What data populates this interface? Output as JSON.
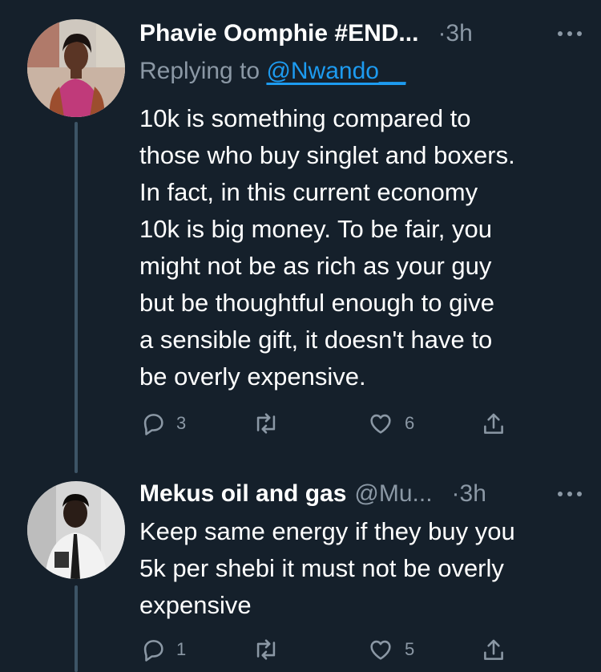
{
  "tweets": [
    {
      "name": "Phavie Oomphie #END...",
      "handle": "",
      "time": "·3h",
      "replying_prefix": "Replying to ",
      "replying_mention": "@Nwando__",
      "lines": [
        "10k is something compared to",
        "those who buy singlet and boxers.",
        "In fact, in this current economy",
        "10k is big money. To be fair, you",
        "might not be as rich as your guy",
        "but be thoughtful enough to give",
        "a sensible gift, it doesn't have to",
        "be overly expensive."
      ],
      "reply_count": "3",
      "retweet_count": "",
      "like_count": "6"
    },
    {
      "name": "Mekus oil and gas",
      "handle": "@Mu...",
      "time": "·3h",
      "lines": [
        "Keep same energy if they buy you",
        "5k per shebi it must not be overly",
        "expensive"
      ],
      "reply_count": "1",
      "retweet_count": "",
      "like_count": "5"
    }
  ],
  "icons": {
    "reply": "reply-icon",
    "retweet": "retweet-icon",
    "like": "heart-icon",
    "share": "share-icon",
    "more": "more-icon"
  },
  "colors": {
    "background": "#15202b",
    "text": "#ffffff",
    "secondary": "#8b98a5",
    "link": "#1d9bf0",
    "thread_line": "#3d5466"
  }
}
